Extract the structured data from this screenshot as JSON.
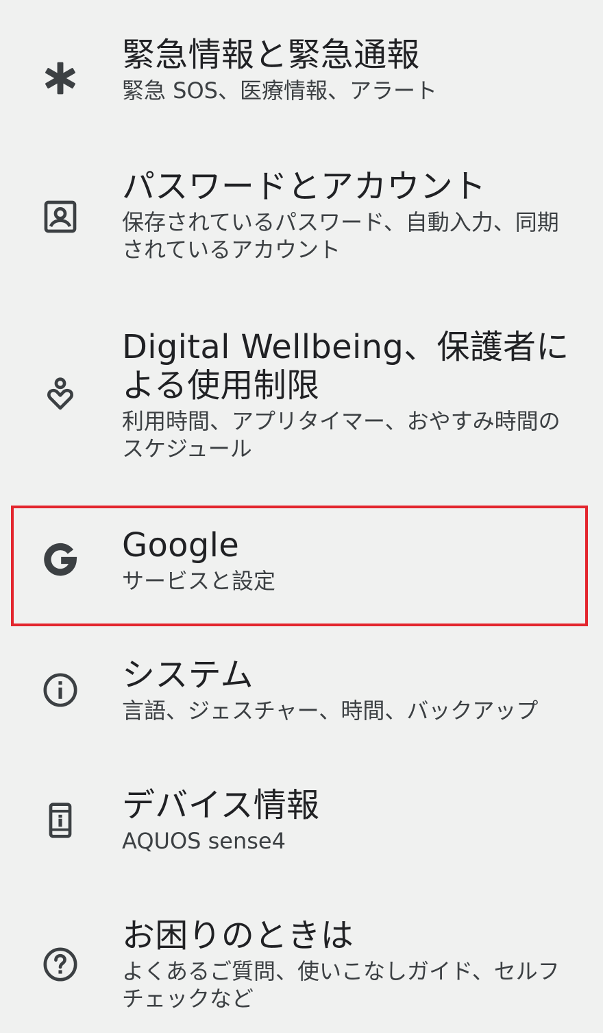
{
  "settings": {
    "items": [
      {
        "id": "emergency",
        "icon": "asterisk-icon",
        "title": "緊急情報と緊急通報",
        "summary": "緊急 SOS、医療情報、アラート"
      },
      {
        "id": "passwords",
        "icon": "account-box-icon",
        "title": "パスワードとアカウント",
        "summary": "保存されているパスワード、自動入力、同期されているアカウント"
      },
      {
        "id": "wellbeing",
        "icon": "wellbeing-icon",
        "title": "Digital Wellbeing、保護者による使用制限",
        "summary": "利用時間、アプリタイマー、おやすみ時間のスケジュール"
      },
      {
        "id": "google",
        "icon": "google-g-icon",
        "title": "Google",
        "summary": "サービスと設定"
      },
      {
        "id": "system",
        "icon": "info-icon",
        "title": "システム",
        "summary": "言語、ジェスチャー、時間、バックアップ"
      },
      {
        "id": "device",
        "icon": "device-info-icon",
        "title": "デバイス情報",
        "summary": "AQUOS sense4"
      },
      {
        "id": "help",
        "icon": "help-icon",
        "title": "お困りのときは",
        "summary": "よくあるご質問、使いこなしガイド、セルフチェックなど"
      }
    ]
  },
  "colors": {
    "background": "#f0f1f0",
    "icon": "#3c4043",
    "title_text": "#202124",
    "summary_text": "#3c4043",
    "highlight_border": "#e3262e"
  }
}
